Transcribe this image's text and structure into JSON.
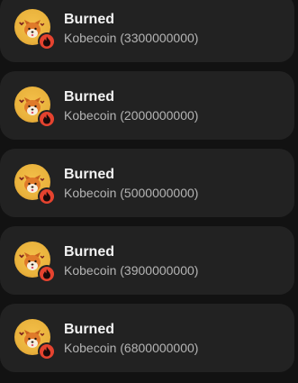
{
  "transactions": [
    {
      "title": "Burned",
      "token": "Kobecoin",
      "amount": "3300000000"
    },
    {
      "title": "Burned",
      "token": "Kobecoin",
      "amount": "2000000000"
    },
    {
      "title": "Burned",
      "token": "Kobecoin",
      "amount": "5000000000"
    },
    {
      "title": "Burned",
      "token": "Kobecoin",
      "amount": "3900000000"
    },
    {
      "title": "Burned",
      "token": "Kobecoin",
      "amount": "6800000000"
    }
  ],
  "icons": {
    "avatar": "shiba-dog-coin-icon",
    "badge": "fire-badge-icon"
  },
  "colors": {
    "background": "#121212",
    "card": "#222222",
    "coin": "#eab33d",
    "burn_badge": "#e5432f"
  }
}
